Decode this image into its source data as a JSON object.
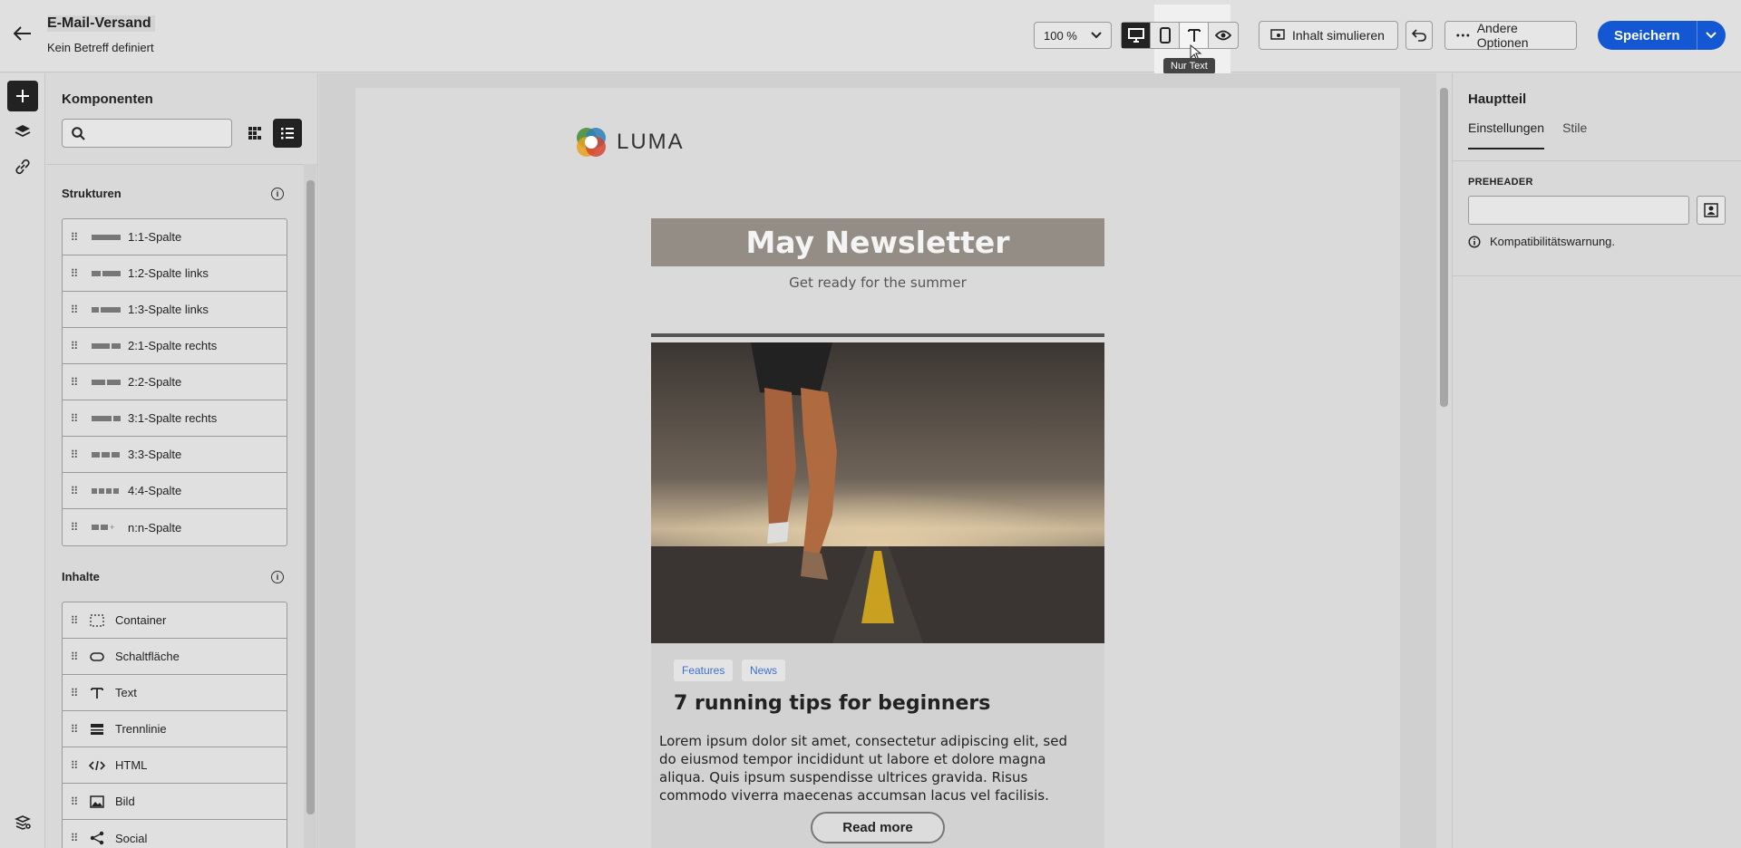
{
  "header": {
    "title": "E-Mail-Versand",
    "subtitle": "Kein Betreff definiert",
    "zoom": "100 %",
    "tooltip": "Nur Text",
    "simulate_label": "Inhalt simulieren",
    "options_label": "Andere Optionen",
    "save_label": "Speichern"
  },
  "components": {
    "title": "Komponenten",
    "search_placeholder": "",
    "structures_title": "Strukturen",
    "structures": [
      {
        "label": "1:1-Spalte"
      },
      {
        "label": "1:2-Spalte links"
      },
      {
        "label": "1:3-Spalte links"
      },
      {
        "label": "2:1-Spalte rechts"
      },
      {
        "label": "2:2-Spalte"
      },
      {
        "label": "3:1-Spalte rechts"
      },
      {
        "label": "3:3-Spalte"
      },
      {
        "label": "4:4-Spalte"
      },
      {
        "label": "n:n-Spalte"
      }
    ],
    "contents_title": "Inhalte",
    "contents": [
      {
        "label": "Container",
        "icon": "container-icon"
      },
      {
        "label": "Schaltfläche",
        "icon": "button-icon"
      },
      {
        "label": "Text",
        "icon": "text-icon"
      },
      {
        "label": "Trennlinie",
        "icon": "divider-icon"
      },
      {
        "label": "HTML",
        "icon": "code-icon"
      },
      {
        "label": "Bild",
        "icon": "image-icon"
      },
      {
        "label": "Social",
        "icon": "share-icon"
      }
    ]
  },
  "email": {
    "logo_text": "LUMA",
    "newsletter_title": "May Newsletter",
    "newsletter_subtitle": "Get ready for the summer",
    "tags": [
      "Features",
      "News"
    ],
    "article_title": "7 running tips for beginners",
    "article_body": "Lorem ipsum dolor sit amet, consectetur adipiscing elit, sed do eiusmod tempor incididunt ut labore et dolore magna aliqua. Quis ipsum suspendisse ultrices gravida. Risus commodo viverra maecenas accumsan lacus vel facilisis.",
    "read_more": "Read more"
  },
  "properties": {
    "title": "Hauptteil",
    "tab_settings": "Einstellungen",
    "tab_styles": "Stile",
    "preheader_label": "PREHEADER",
    "preheader_value": "",
    "warning": "Kompatibilitätswarnung."
  },
  "colors": {
    "primary": "#1457d2",
    "tag_text": "#3c6fd1",
    "title_band": "#938d86"
  }
}
